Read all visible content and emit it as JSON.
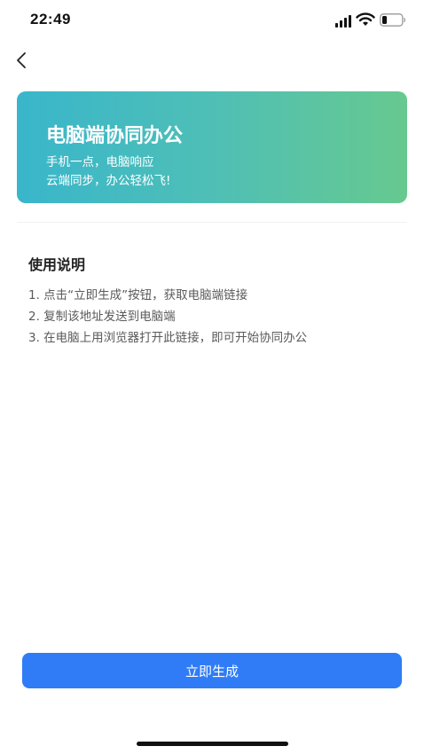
{
  "status_bar": {
    "time": "22:49",
    "icons": [
      "signal-icon",
      "wifi-icon",
      "battery-icon"
    ]
  },
  "nav": {
    "back_icon": "chevron-left-icon"
  },
  "banner": {
    "title": "电脑端协同办公",
    "subtitle_line1": "手机一点，电脑响应",
    "subtitle_line2": "云端同步，办公轻松飞!",
    "gradient_start": "#39b6cb",
    "gradient_end": "#67c98f"
  },
  "instructions": {
    "title": "使用说明",
    "steps": [
      "1. 点击“立即生成”按钮，获取电脑端链接",
      "2. 复制该地址发送到电脑端",
      "3. 在电脑上用浏览器打开此链接，即可开始协同办公"
    ]
  },
  "action": {
    "generate_label": "立即生成",
    "color": "#2f7cf6"
  }
}
